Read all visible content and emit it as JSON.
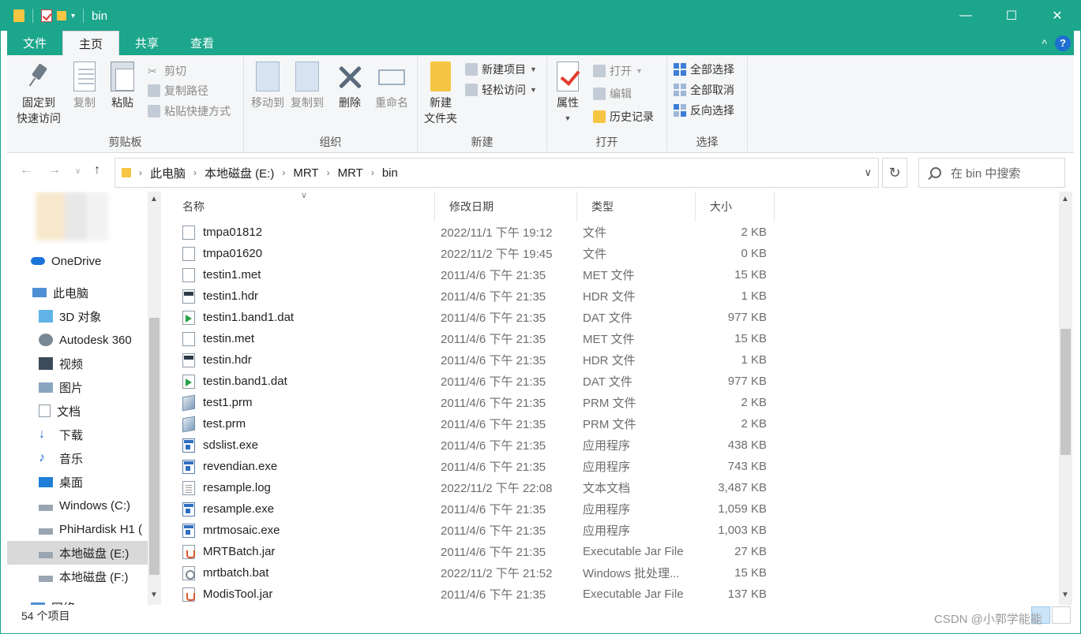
{
  "window": {
    "title": "bin"
  },
  "controls": {
    "minimize": "—",
    "maximize": "☐",
    "close": "✕",
    "chevron": "^",
    "help": "?"
  },
  "tabs": [
    {
      "label": "文件"
    },
    {
      "label": "主页"
    },
    {
      "label": "共享"
    },
    {
      "label": "查看"
    }
  ],
  "ribbon": {
    "clipboard": {
      "group": "剪贴板",
      "pin_line1": "固定到",
      "pin_line2": "快速访问",
      "copy": "复制",
      "paste": "粘贴",
      "cut": "剪切",
      "copy_path": "复制路径",
      "paste_shortcut": "粘贴快捷方式"
    },
    "organize": {
      "group": "组织",
      "move_to": "移动到",
      "copy_to": "复制到",
      "delete": "删除",
      "rename": "重命名"
    },
    "new": {
      "group": "新建",
      "new_folder_line1": "新建",
      "new_folder_line2": "文件夹",
      "new_item": "新建项目",
      "easy_access": "轻松访问"
    },
    "open": {
      "group": "打开",
      "properties": "属性",
      "open": "打开",
      "edit": "编辑",
      "history": "历史记录"
    },
    "select": {
      "group": "选择",
      "select_all": "全部选择",
      "select_none": "全部取消",
      "invert": "反向选择"
    }
  },
  "address": {
    "crumbs": [
      "此电脑",
      "本地磁盘 (E:)",
      "MRT",
      "MRT",
      "bin"
    ],
    "search_placeholder": "在 bin 中搜索"
  },
  "nav": {
    "items": [
      {
        "label": "OneDrive",
        "icon": "cloud-icon"
      },
      {
        "label": "此电脑",
        "icon": "computer-icon"
      },
      {
        "label": "3D 对象",
        "icon": "cube-icon"
      },
      {
        "label": "Autodesk 360",
        "icon": "autodesk-icon"
      },
      {
        "label": "视频",
        "icon": "video-icon"
      },
      {
        "label": "图片",
        "icon": "picture-icon"
      },
      {
        "label": "文档",
        "icon": "document-icon"
      },
      {
        "label": "下载",
        "icon": "download-icon"
      },
      {
        "label": "音乐",
        "icon": "music-icon"
      },
      {
        "label": "桌面",
        "icon": "desktop-icon"
      },
      {
        "label": "Windows (C:)",
        "icon": "drive-icon"
      },
      {
        "label": "PhiHardisk H1 (",
        "icon": "drive-icon"
      },
      {
        "label": "本地磁盘 (E:)",
        "icon": "drive-icon"
      },
      {
        "label": "本地磁盘 (F:)",
        "icon": "drive-icon"
      },
      {
        "label": "网络",
        "icon": "network-icon"
      }
    ]
  },
  "columns": {
    "name": "名称",
    "date": "修改日期",
    "type": "类型",
    "size": "大小"
  },
  "files": [
    {
      "name": "tmpa01812",
      "date": "2022/11/1 下午 19:12",
      "type": "文件",
      "size": "2 KB",
      "icon": "blank"
    },
    {
      "name": "tmpa01620",
      "date": "2022/11/2 下午 19:45",
      "type": "文件",
      "size": "0 KB",
      "icon": "blank"
    },
    {
      "name": "testin1.met",
      "date": "2011/4/6 下午 21:35",
      "type": "MET 文件",
      "size": "15 KB",
      "icon": "blank"
    },
    {
      "name": "testin1.hdr",
      "date": "2011/4/6 下午 21:35",
      "type": "HDR 文件",
      "size": "1 KB",
      "icon": "hdr"
    },
    {
      "name": "testin1.band1.dat",
      "date": "2011/4/6 下午 21:35",
      "type": "DAT 文件",
      "size": "977 KB",
      "icon": "dat"
    },
    {
      "name": "testin.met",
      "date": "2011/4/6 下午 21:35",
      "type": "MET 文件",
      "size": "15 KB",
      "icon": "blank"
    },
    {
      "name": "testin.hdr",
      "date": "2011/4/6 下午 21:35",
      "type": "HDR 文件",
      "size": "1 KB",
      "icon": "hdr"
    },
    {
      "name": "testin.band1.dat",
      "date": "2011/4/6 下午 21:35",
      "type": "DAT 文件",
      "size": "977 KB",
      "icon": "dat"
    },
    {
      "name": "test1.prm",
      "date": "2011/4/6 下午 21:35",
      "type": "PRM 文件",
      "size": "2 KB",
      "icon": "prm"
    },
    {
      "name": "test.prm",
      "date": "2011/4/6 下午 21:35",
      "type": "PRM 文件",
      "size": "2 KB",
      "icon": "prm"
    },
    {
      "name": "sdslist.exe",
      "date": "2011/4/6 下午 21:35",
      "type": "应用程序",
      "size": "438 KB",
      "icon": "exe"
    },
    {
      "name": "revendian.exe",
      "date": "2011/4/6 下午 21:35",
      "type": "应用程序",
      "size": "743 KB",
      "icon": "exe"
    },
    {
      "name": "resample.log",
      "date": "2022/11/2 下午 22:08",
      "type": "文本文档",
      "size": "3,487 KB",
      "icon": "log"
    },
    {
      "name": "resample.exe",
      "date": "2011/4/6 下午 21:35",
      "type": "应用程序",
      "size": "1,059 KB",
      "icon": "exe"
    },
    {
      "name": "mrtmosaic.exe",
      "date": "2011/4/6 下午 21:35",
      "type": "应用程序",
      "size": "1,003 KB",
      "icon": "exe"
    },
    {
      "name": "MRTBatch.jar",
      "date": "2011/4/6 下午 21:35",
      "type": "Executable Jar File",
      "size": "27 KB",
      "icon": "jar"
    },
    {
      "name": "mrtbatch.bat",
      "date": "2022/11/2 下午 21:52",
      "type": "Windows 批处理...",
      "size": "15 KB",
      "icon": "bat"
    },
    {
      "name": "ModisTool.jar",
      "date": "2011/4/6 下午 21:35",
      "type": "Executable Jar File",
      "size": "137 KB",
      "icon": "jar"
    }
  ],
  "status": {
    "count": "54 个项目"
  },
  "watermark": "CSDN @小郭学能能",
  "colors": {
    "titlebar": "#1ca68c",
    "selected_nav": "#d9d9d9"
  }
}
